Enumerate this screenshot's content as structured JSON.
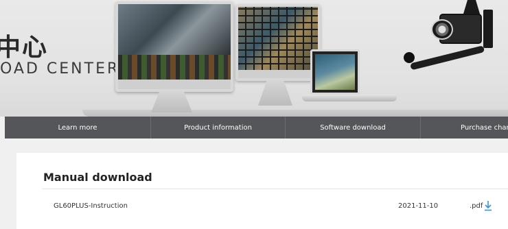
{
  "banner": {
    "title": "中心",
    "subtitle": "OAD CENTER"
  },
  "nav": {
    "items": [
      {
        "label": "Learn more"
      },
      {
        "label": "Product information"
      },
      {
        "label": "Software download"
      },
      {
        "label": "Purchase chann"
      }
    ]
  },
  "manual": {
    "title": "Manual download",
    "files": [
      {
        "name": "GL60PLUS-Instruction",
        "date": "2021-11-10",
        "format": ".pdf",
        "icon": "download-icon"
      }
    ]
  },
  "colors": {
    "nav_background": "#555659",
    "nav_text": "#ffffff",
    "download_icon": "#3b8fd8",
    "page_background": "#f0f0f0"
  }
}
